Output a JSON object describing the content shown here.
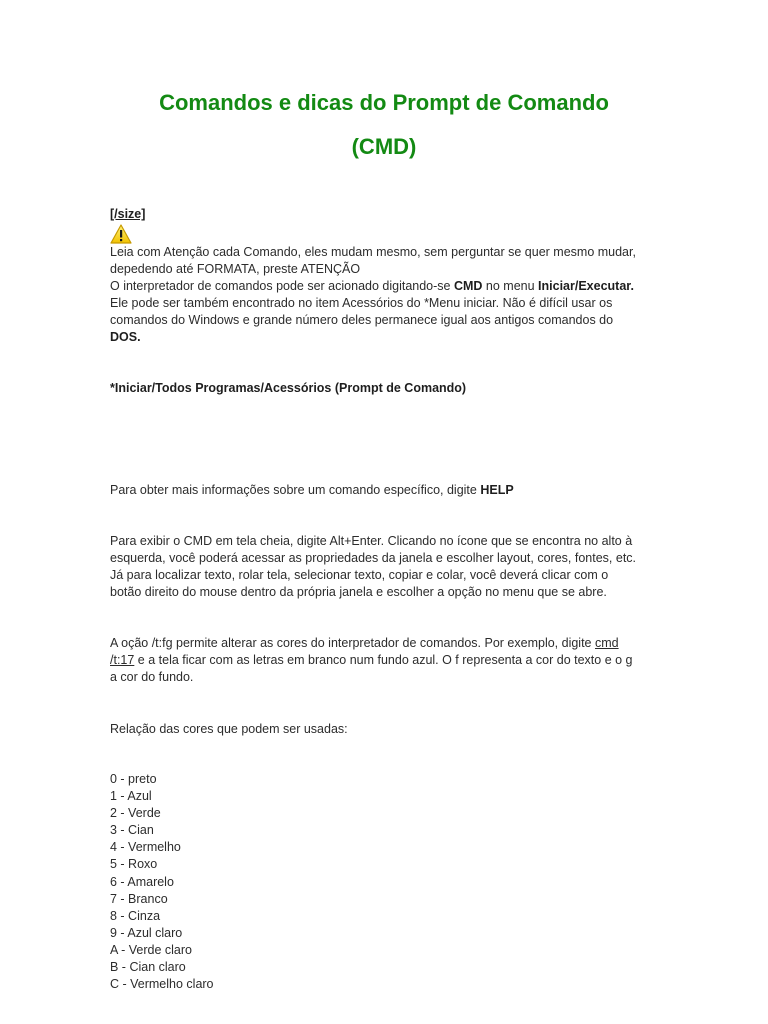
{
  "document": {
    "title_line1": "Comandos e dicas do Prompt de Comando",
    "title_line2": "(CMD)",
    "size_tag": "[/size]",
    "warning_icon": "warning-triangle-icon",
    "p1_line1": "Leia com Atenção cada Comando, eles mudam mesmo, sem perguntar se quer mesmo mudar,",
    "p1_line2": "depedendo até FORMATA, preste ATENÇÃO",
    "p2_a": "O interpretador de comandos pode ser acionado digitando-se ",
    "p2_b": "CMD",
    "p2_c": " no menu ",
    "p2_d": "Iniciar/Executar.",
    "p2_line2": "Ele pode ser também encontrado no item Acessórios do *Menu iniciar. Não é difícil usar os",
    "p2_line3": "comandos do Windows e grande número deles permanece igual aos antigos comandos do",
    "p2_line4": "DOS.",
    "path": "*Iniciar/Todos Programas/Acessórios (Prompt de Comando)",
    "help_a": "Para obter mais informações sobre um comando específico, digite ",
    "help_b": "HELP",
    "p3_line1": "Para exibir o CMD em tela cheia, digite Alt+Enter. Clicando no ícone que se encontra no alto à",
    "p3_line2": "esquerda, você poderá acessar as propriedades da janela e escolher layout, cores, fontes, etc.",
    "p3_line3": "Já para localizar texto, rolar tela, selecionar texto, copiar e colar, você deverá clicar com o",
    "p3_line4": "botão direito do mouse dentro da própria janela e escolher a opção no menu que se abre.",
    "p4_a": "A oção /t:fg permite alterar as cores do interpretador de comandos. Por exemplo, digite ",
    "p4_link1": "cmd",
    "p4_link2": "/t:17",
    "p4_b": " e a tela ficar com as letras em branco num fundo azul. O f representa a cor do texto e o g",
    "p4_line3": "a cor do fundo.",
    "colors_intro": "Relação das cores que podem ser usadas:",
    "colors": [
      "0 - preto",
      "1 - Azul",
      "2 - Verde",
      "3 - Cian",
      "4 - Vermelho",
      "5 - Roxo",
      "6 - Amarelo",
      "7 - Branco",
      "8 - Cinza",
      "9 - Azul claro",
      "A - Verde claro",
      "B - Cian claro",
      "C - Vermelho claro"
    ],
    "title_color": "#138a13"
  }
}
